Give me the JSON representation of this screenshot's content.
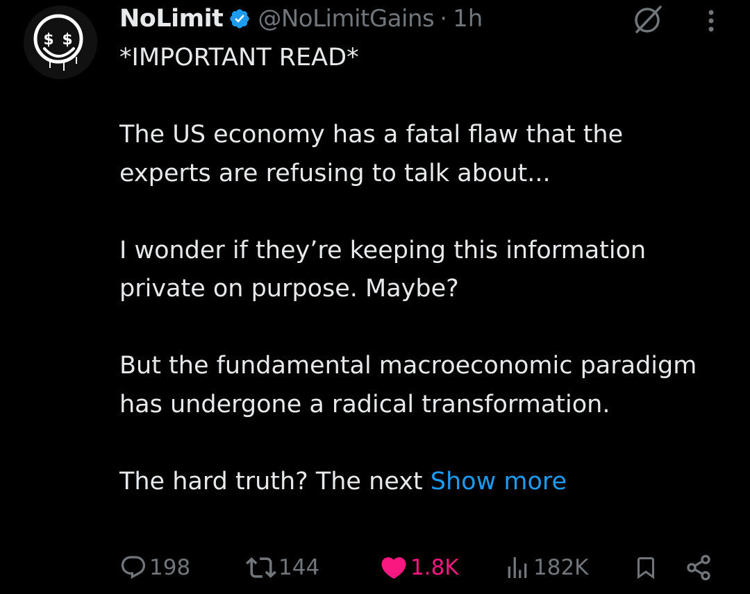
{
  "author": {
    "display_name": "NoLimit",
    "handle": "@NoLimitGains",
    "separator": "·",
    "time": "1h",
    "avatar_icon": "dollar-eyes-smiley-icon",
    "verified_color": "#1d9bf0"
  },
  "tweet": {
    "paragraphs": [
      "*IMPORTANT READ*",
      "The US economy has a fatal flaw that the experts are refusing to talk about...",
      "I wonder if they’re keeping this information private on purpose. Maybe?",
      "But the fundamental macroeconomic paradigm has undergone a radical transformation."
    ],
    "last_paragraph": "The hard truth? The next",
    "show_more": "Show more"
  },
  "actions": {
    "replies": "198",
    "reposts": "144",
    "likes": "1.8K",
    "views": "182K",
    "liked": true,
    "like_color": "#f91880"
  },
  "colors": {
    "background": "#000000",
    "text_primary": "#e7e9ea",
    "text_secondary": "#71767b",
    "link": "#1d9bf0"
  }
}
